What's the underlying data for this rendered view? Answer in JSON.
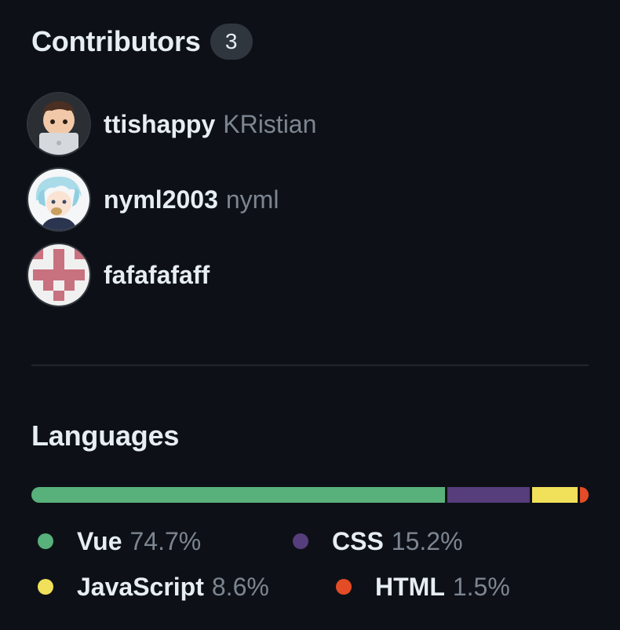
{
  "contributors": {
    "title": "Contributors",
    "count": "3",
    "items": [
      {
        "login": "ttishappy",
        "name": "KRistian",
        "avatar": "laptop-avatar-icon"
      },
      {
        "login": "nyml2003",
        "name": "nyml",
        "avatar": "anime-avatar-icon"
      },
      {
        "login": "fafafafaff",
        "name": "",
        "avatar": "identicon-avatar-icon"
      }
    ]
  },
  "languages": {
    "title": "Languages",
    "items": [
      {
        "name": "Vue",
        "percent": "74.7%",
        "value": 74.7,
        "color": "#58b07a"
      },
      {
        "name": "CSS",
        "percent": "15.2%",
        "value": 15.2,
        "color": "#563d7c"
      },
      {
        "name": "JavaScript",
        "percent": "8.6%",
        "value": 8.6,
        "color": "#f1e05a"
      },
      {
        "name": "HTML",
        "percent": "1.5%",
        "value": 1.5,
        "color": "#e34c26"
      }
    ]
  }
}
